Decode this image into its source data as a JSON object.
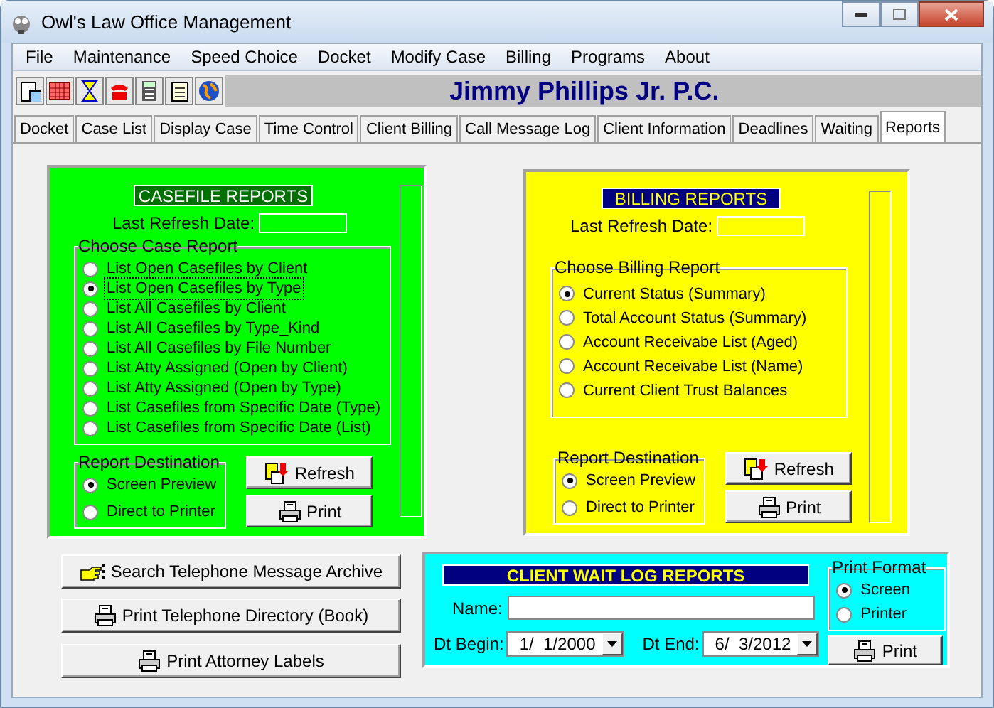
{
  "window": {
    "title": "Owl's Law Office Management"
  },
  "menu": [
    "File",
    "Maintenance",
    "Speed Choice",
    "Docket",
    "Modify Case",
    "Billing",
    "Programs",
    "About"
  ],
  "firm_name": "Jimmy Phillips Jr. P.C.",
  "tabs": [
    {
      "label": "Docket",
      "selected": false
    },
    {
      "label": "Case List",
      "selected": false
    },
    {
      "label": "Display Case",
      "selected": false
    },
    {
      "label": "Time Control",
      "selected": false
    },
    {
      "label": "Client Billing",
      "selected": false
    },
    {
      "label": "Call Message Log",
      "selected": false
    },
    {
      "label": "Client Information",
      "selected": false
    },
    {
      "label": "Deadlines",
      "selected": false
    },
    {
      "label": "Waiting",
      "selected": false
    },
    {
      "label": "Reports",
      "selected": true
    }
  ],
  "casefile_reports": {
    "title": "CASEFILE REPORTS",
    "last_refresh_label": "Last Refresh Date:",
    "report_group": {
      "legend": "Choose Case Report",
      "options": [
        {
          "label": "List Open Casefiles by Client",
          "selected": false,
          "focused": false
        },
        {
          "label": "List Open Casefiles by Type",
          "selected": true,
          "focused": true
        },
        {
          "label": "List All Casefiles by Client",
          "selected": false,
          "focused": false
        },
        {
          "label": "List All Casefiles by Type_Kind",
          "selected": false,
          "focused": false
        },
        {
          "label": "List All Casefiles by File Number",
          "selected": false,
          "focused": false
        },
        {
          "label": "List Atty Assigned (Open by Client)",
          "selected": false,
          "focused": false
        },
        {
          "label": "List Atty Assigned (Open by Type)",
          "selected": false,
          "focused": false
        },
        {
          "label": "List Casefiles from Specific Date (Type)",
          "selected": false,
          "focused": false
        },
        {
          "label": "List Casefiles from Specific Date (List)",
          "selected": false,
          "focused": false
        }
      ]
    },
    "destination": {
      "legend": "Report Destination",
      "options": [
        {
          "label": "Screen Preview",
          "selected": true
        },
        {
          "label": "Direct to Printer",
          "selected": false
        }
      ]
    },
    "refresh_button": "Refresh",
    "print_button": "Print"
  },
  "billing_reports": {
    "title": "BILLING REPORTS",
    "last_refresh_label": "Last Refresh Date:",
    "report_group": {
      "legend": "Choose Billing Report",
      "options": [
        {
          "label": "Current Status (Summary)",
          "selected": true
        },
        {
          "label": "Total Account Status (Summary)",
          "selected": false
        },
        {
          "label": "Account Receivabe List (Aged)",
          "selected": false
        },
        {
          "label": "Account Receivabe List (Name)",
          "selected": false
        },
        {
          "label": "Current Client Trust Balances",
          "selected": false
        }
      ]
    },
    "destination": {
      "legend": "Report Destination",
      "options": [
        {
          "label": "Screen Preview",
          "selected": true
        },
        {
          "label": "Direct to Printer",
          "selected": false
        }
      ]
    },
    "refresh_button": "Refresh",
    "print_button": "Print"
  },
  "side_buttons": [
    {
      "kind": "search",
      "label": "Search Telephone Message Archive"
    },
    {
      "kind": "print",
      "label": "Print Telephone Directory (Book)"
    },
    {
      "kind": "print",
      "label": "Print Attorney Labels"
    }
  ],
  "wait_log": {
    "title": "CLIENT WAIT LOG REPORTS",
    "name_label": "Name:",
    "dt_begin_label": "Dt Begin:",
    "dt_begin": "1/  1/2000",
    "dt_end_label": "Dt End:",
    "dt_end": "6/  3/2012",
    "print_format": {
      "legend": "Print Format",
      "options": [
        {
          "label": "Screen",
          "selected": true
        },
        {
          "label": "Printer",
          "selected": false
        }
      ]
    },
    "print_button": "Print"
  }
}
